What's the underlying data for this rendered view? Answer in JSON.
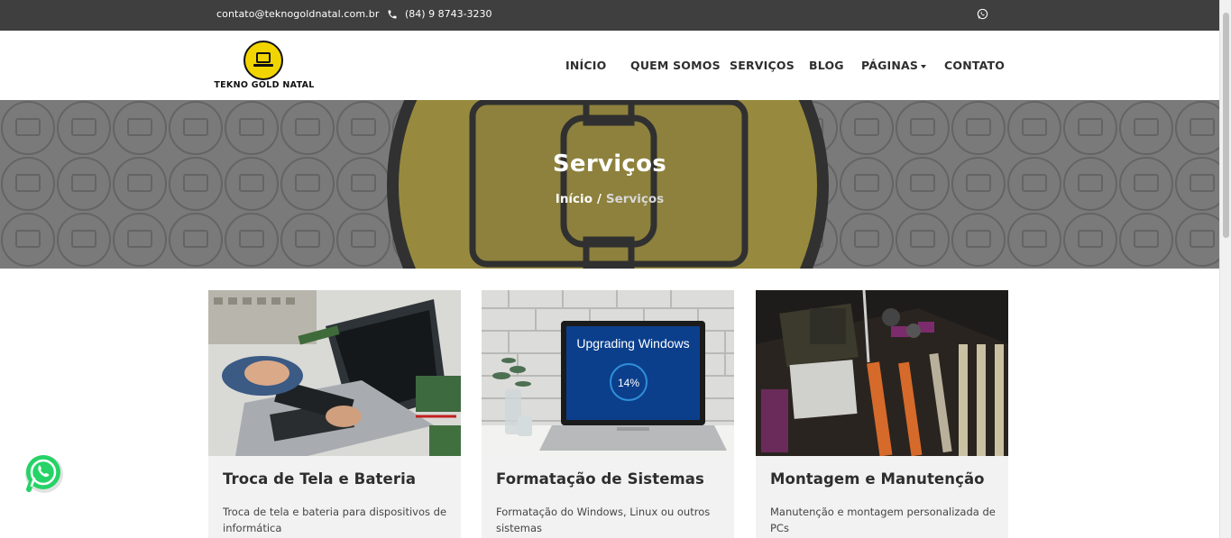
{
  "topbar": {
    "email": "contato@teknogoldnatal.com.br",
    "phone": "(84) 9 8743-3230",
    "icons": [
      "phone-icon",
      "whatsapp-icon"
    ]
  },
  "header": {
    "logo_text": "TEKNO GOLD NATAL",
    "nav": [
      {
        "label": "INÍCIO"
      },
      {
        "label": "QUEM SOMOS"
      },
      {
        "label": "SERVIÇOS"
      },
      {
        "label": "BLOG"
      },
      {
        "label": "PÁGINAS",
        "has_dropdown": true
      },
      {
        "label": "CONTATO"
      }
    ]
  },
  "hero": {
    "title": "Serviços",
    "breadcrumb": {
      "home": "Início",
      "separator": "/",
      "current": "Serviços"
    }
  },
  "cards": [
    {
      "title": "Troca de Tela e Bateria",
      "description": "Troca de tela e bateria para dispositivos de informática"
    },
    {
      "title": "Formatação de Sistemas",
      "description": "Formatação do Windows, Linux ou outros sistemas",
      "image_text": "Upgrading Windows",
      "image_progress": "14%"
    },
    {
      "title": "Montagem e Manutenção",
      "description": "Manutenção e montagem personalizada de PCs"
    }
  ],
  "colors": {
    "topbar": "#3f3f3f",
    "accent_yellow": "#f2d500",
    "card_bg": "#f2f2f2",
    "whatsapp": "#25d366"
  }
}
